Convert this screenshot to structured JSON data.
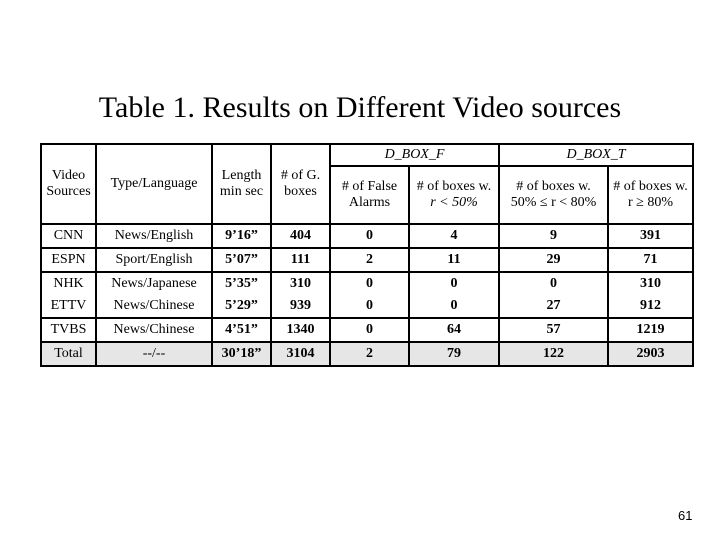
{
  "title": "Table 1. Results on Different Video sources",
  "table": {
    "group_headers": {
      "d_box_f": "D_BOX_F",
      "d_box_t": "D_BOX_T"
    },
    "columns": [
      {
        "line1": "Video",
        "line2": "Sources"
      },
      {
        "line1": "Type/Language",
        "line2": ""
      },
      {
        "line1": "Length",
        "line2": "min sec"
      },
      {
        "line1": "# of G.",
        "line2": "boxes"
      },
      {
        "line1": "# of False",
        "line2": "Alarms"
      },
      {
        "line1": "# of boxes w.",
        "line2": "r < 50%"
      },
      {
        "line1": "# of boxes w.",
        "line2": "50% ≤ r < 80%"
      },
      {
        "line1": "# of boxes w.",
        "line2": "r ≥ 80%"
      }
    ],
    "rows": [
      {
        "source": "CNN",
        "type": "News/English",
        "length": "9’16”",
        "g_boxes": "404",
        "false_alarms": "0",
        "lt50": "4",
        "50to80": "9",
        "ge80": "391"
      },
      {
        "source": "ESPN",
        "type": "Sport/English",
        "length": "5’07”",
        "g_boxes": "111",
        "false_alarms": "2",
        "lt50": "11",
        "50to80": "29",
        "ge80": "71"
      },
      {
        "source": "NHK",
        "type": "News/Japanese",
        "length": "5’35”",
        "g_boxes": "310",
        "false_alarms": "0",
        "lt50": "0",
        "50to80": "0",
        "ge80": "310"
      },
      {
        "source": "ETTV",
        "type": "News/Chinese",
        "length": "5’29”",
        "g_boxes": "939",
        "false_alarms": "0",
        "lt50": "0",
        "50to80": "27",
        "ge80": "912"
      },
      {
        "source": "TVBS",
        "type": "News/Chinese",
        "length": "4’51”",
        "g_boxes": "1340",
        "false_alarms": "0",
        "lt50": "64",
        "50to80": "57",
        "ge80": "1219"
      }
    ],
    "total": {
      "source": "Total",
      "type": "--/--",
      "length": "30’18”",
      "g_boxes": "3104",
      "false_alarms": "2",
      "lt50": "79",
      "50to80": "122",
      "ge80": "2903"
    }
  },
  "page_number": "61"
}
